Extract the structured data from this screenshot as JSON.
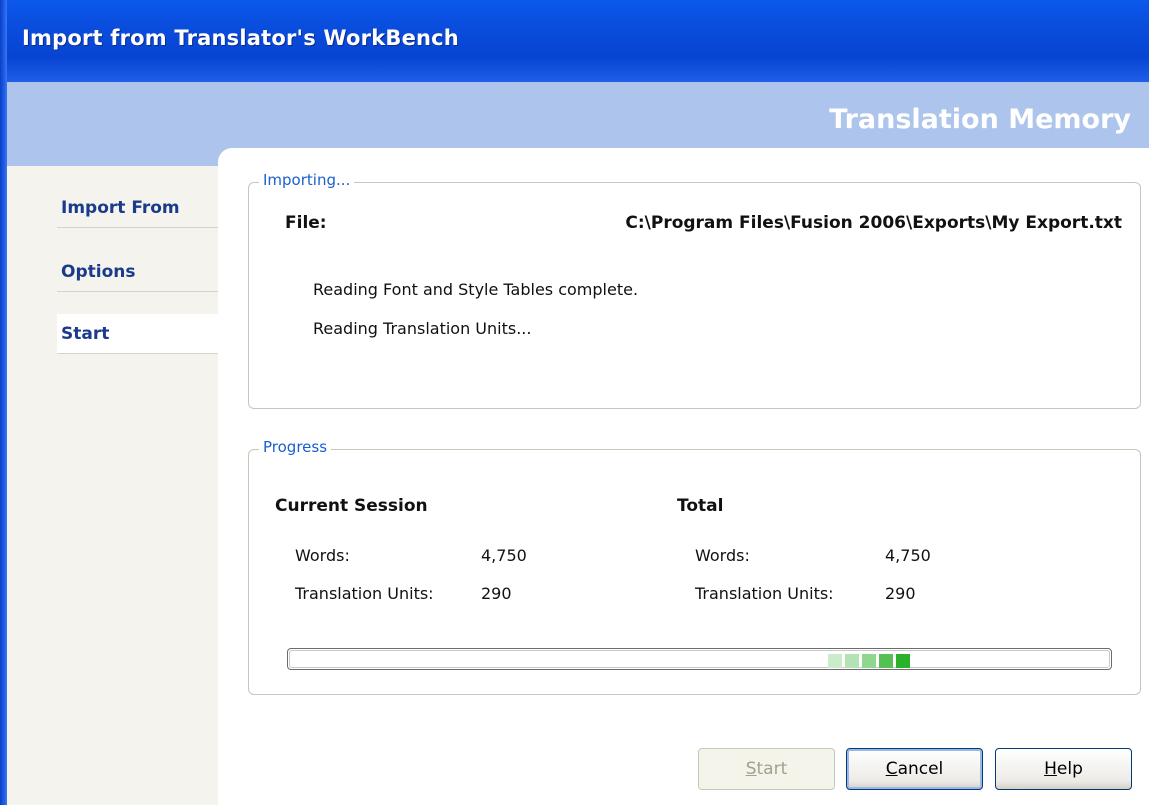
{
  "window": {
    "title": "Import from Translator's WorkBench"
  },
  "banner": {
    "title": "Translation Memory"
  },
  "nav": {
    "items": [
      {
        "label": "Import From"
      },
      {
        "label": "Options"
      },
      {
        "label": "Start"
      }
    ],
    "active": "Start"
  },
  "importing": {
    "legend": "Importing...",
    "file_label": "File:",
    "file_path": "C:\\Program Files\\Fusion 2006\\Exports\\My Export.txt",
    "log": [
      "Reading Font and Style Tables complete.",
      "Reading Translation Units..."
    ]
  },
  "progress": {
    "legend": "Progress",
    "current": {
      "heading": "Current Session",
      "words_label": "Words:",
      "words_value": "4,750",
      "tu_label": "Translation Units:",
      "tu_value": "290"
    },
    "total": {
      "heading": "Total",
      "words_label": "Words:",
      "words_value": "4,750",
      "tu_label": "Translation Units:",
      "tu_value": "290"
    }
  },
  "buttons": {
    "start": {
      "accel": "S",
      "rest": "tart"
    },
    "cancel": {
      "accel": "C",
      "rest": "ancel"
    },
    "help": {
      "accel": "H",
      "rest": "elp"
    }
  },
  "colors": {
    "titlebar": "#0a4fe0",
    "banner": "#adc4ec",
    "nav_text": "#1a3a8c",
    "legend_text": "#1a5fd0",
    "progress_segments": [
      "#cbeccb",
      "#b3e3b3",
      "#8fd68f",
      "#55c155",
      "#2bb02b"
    ]
  }
}
